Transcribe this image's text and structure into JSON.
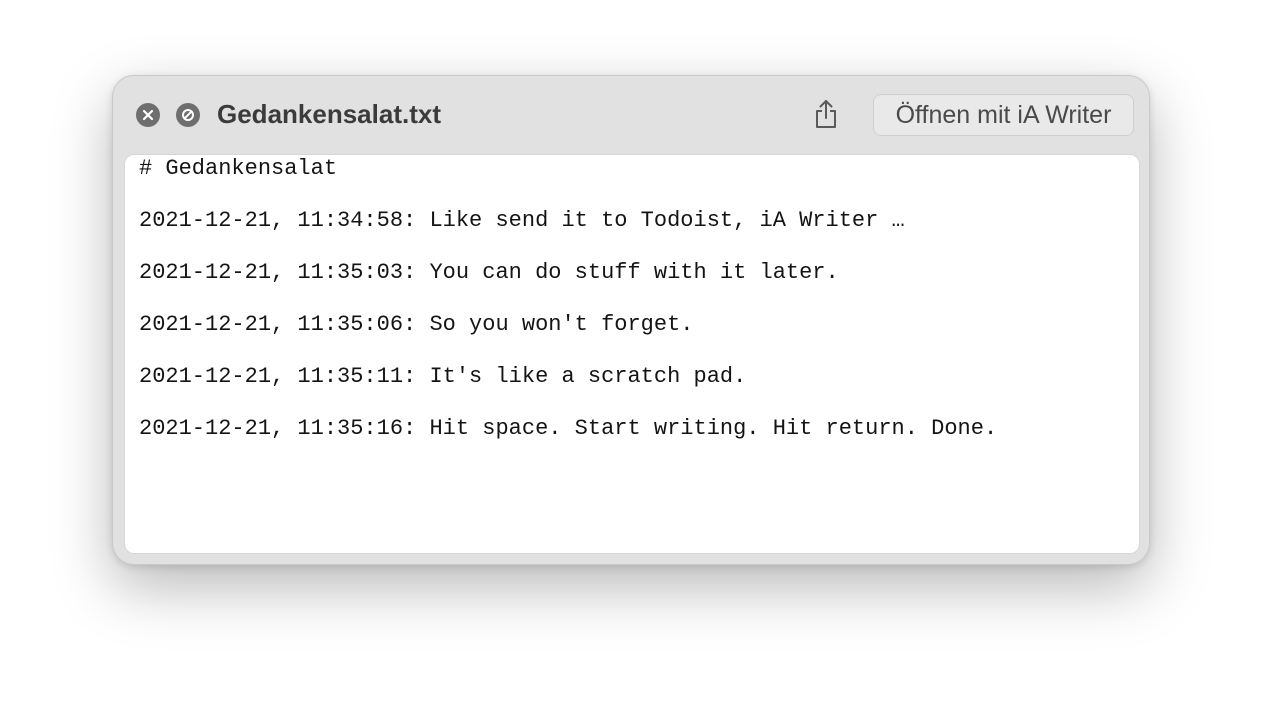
{
  "window": {
    "title": "Gedankensalat.txt",
    "open_button_label": "Öffnen mit iA Writer",
    "icons": {
      "close": "close-icon",
      "disable": "disable-icon",
      "share": "share-icon"
    }
  },
  "document": {
    "lines": [
      "# Gedankensalat",
      "2021-12-21, 11:34:58: Like send it to Todoist, iA Writer …",
      "2021-12-21, 11:35:03: You can do stuff with it later.",
      "2021-12-21, 11:35:06: So you won't forget.",
      "2021-12-21, 11:35:11: It's like a scratch pad.",
      "2021-12-21, 11:35:16: Hit space. Start writing. Hit return. Done."
    ]
  },
  "colors": {
    "window_background": "#e1e1e1",
    "content_background": "#ffffff",
    "icon_gray": "#6e6e6e",
    "text": "#141414"
  }
}
